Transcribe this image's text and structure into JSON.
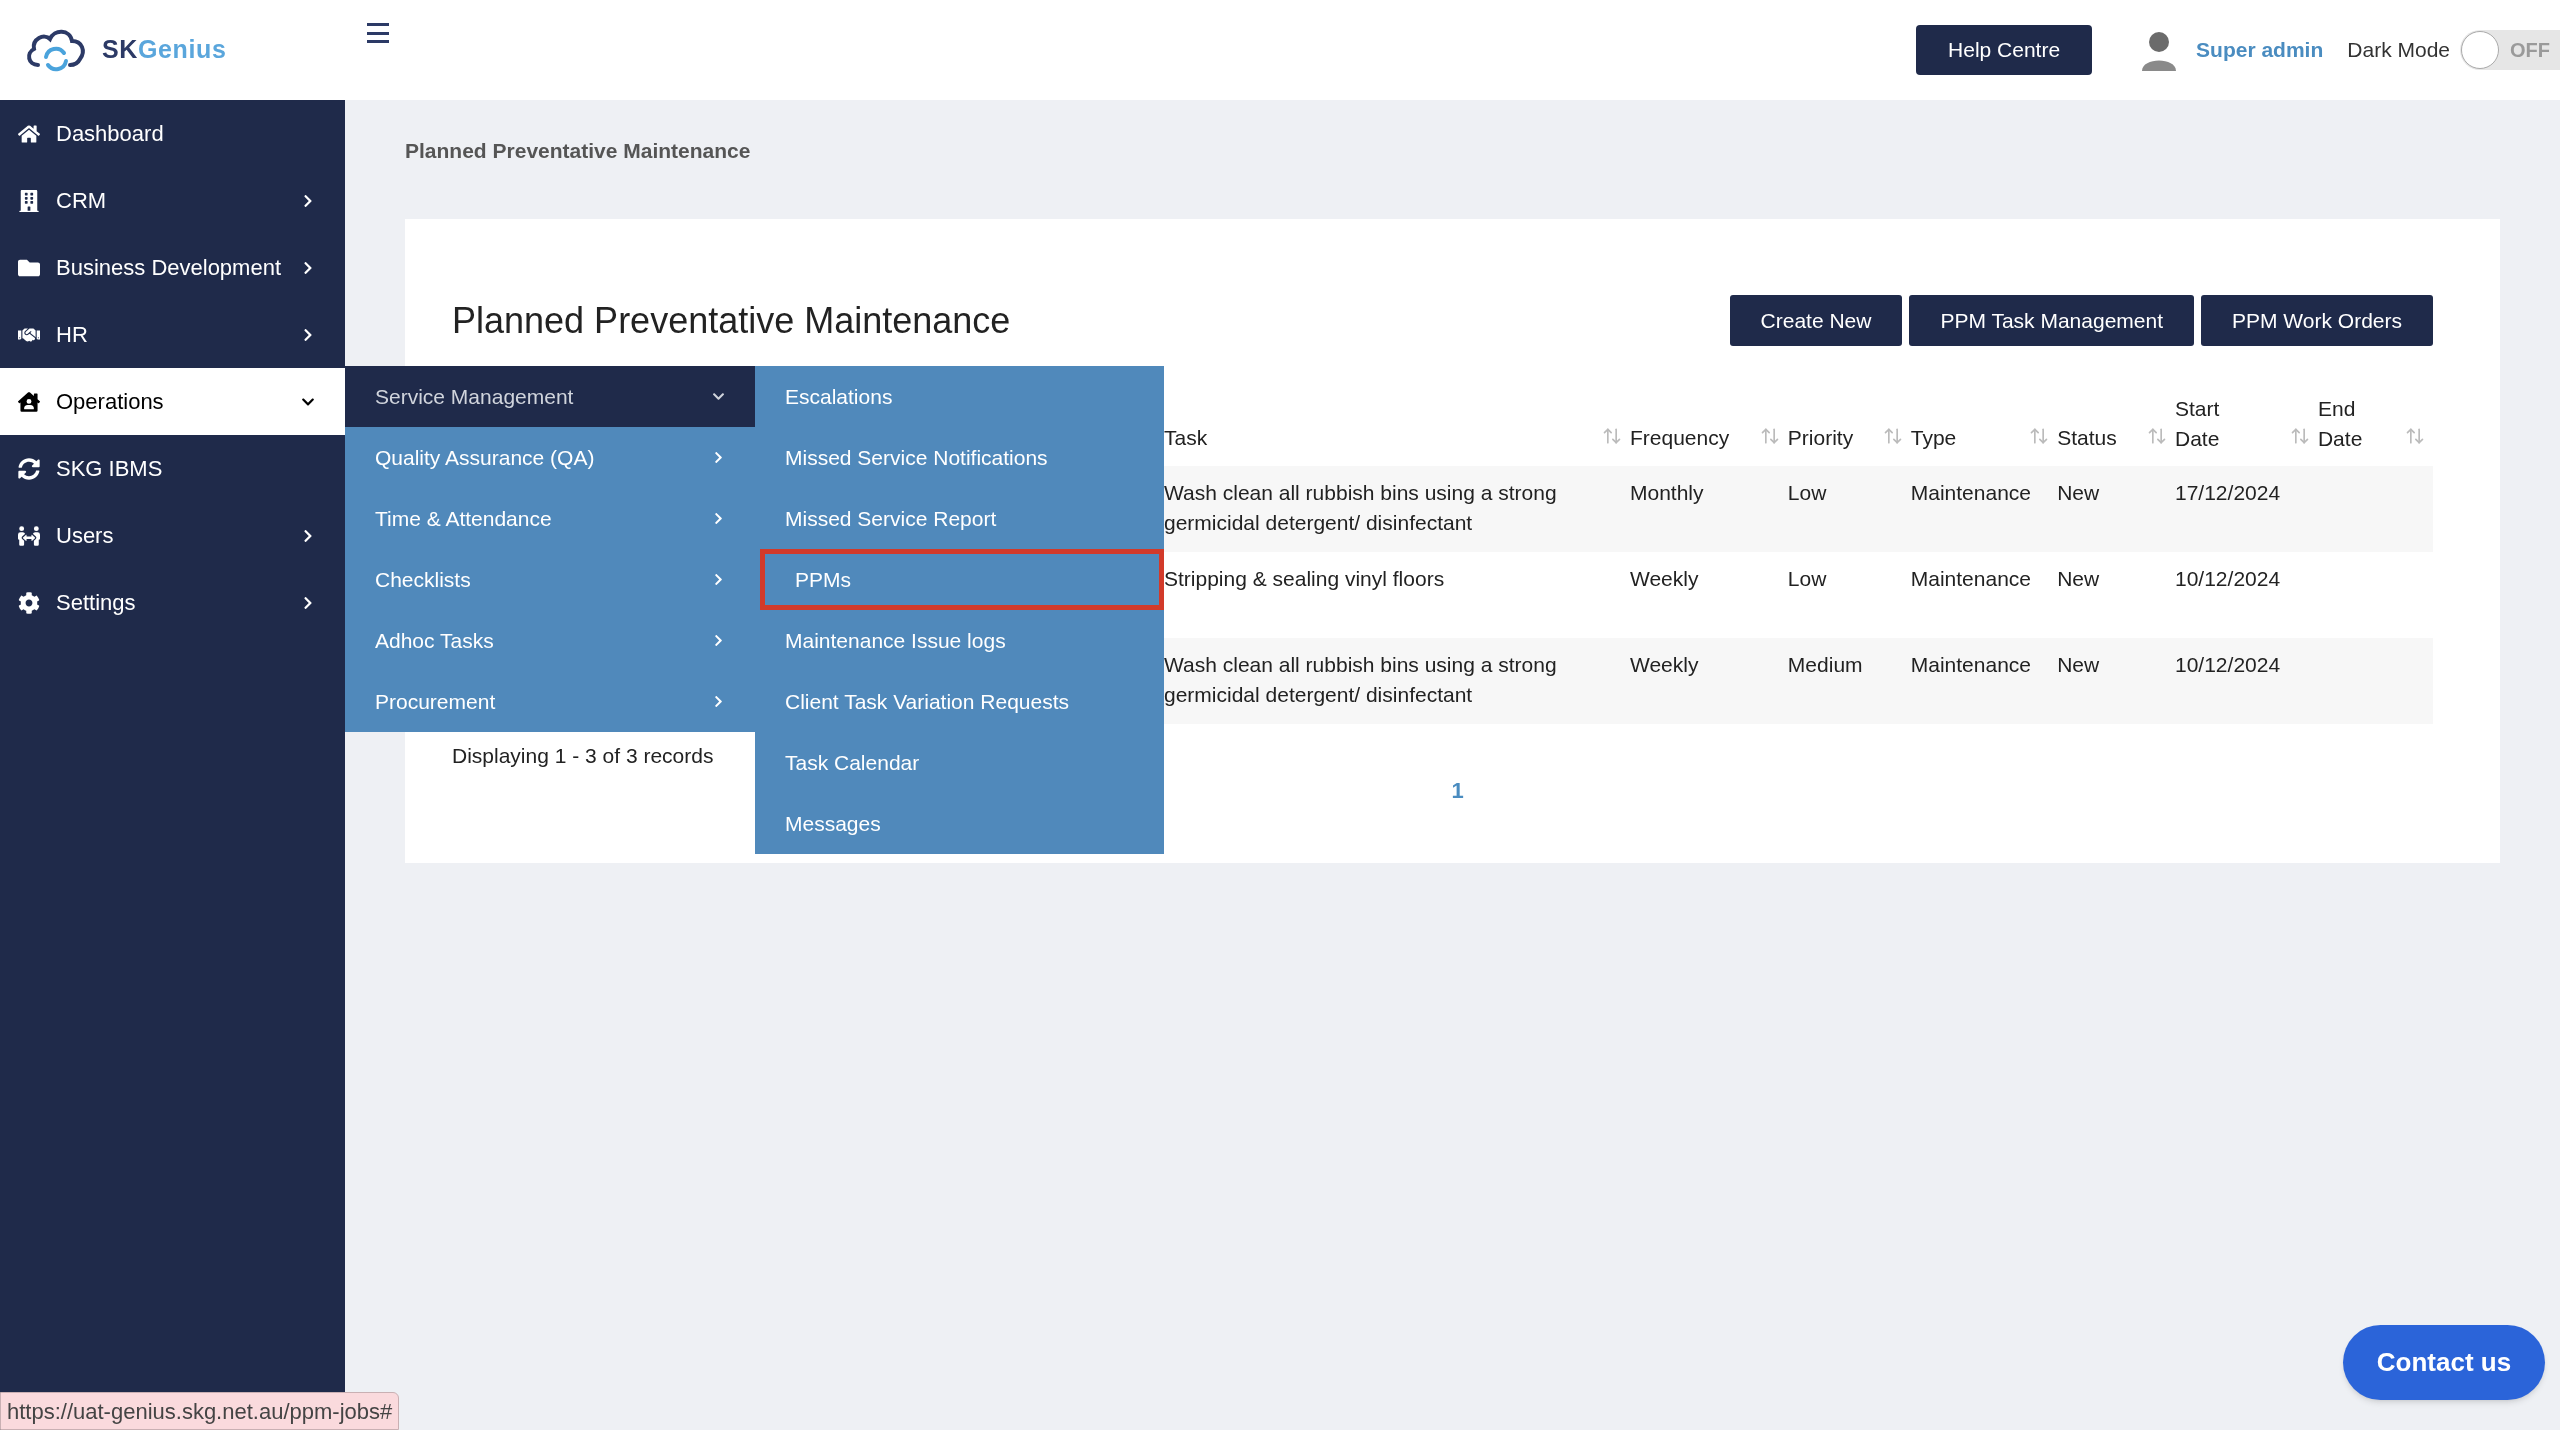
{
  "header": {
    "brand_parts": [
      "SK",
      "Genius"
    ],
    "help_button": "Help Centre",
    "user_name": "Super admin",
    "dark_mode": {
      "label": "Dark Mode",
      "on": false,
      "state_text": "OFF"
    }
  },
  "sidebar": {
    "items": [
      {
        "label": "Dashboard",
        "submenu": false,
        "selected": false
      },
      {
        "label": "CRM",
        "submenu": true,
        "selected": false,
        "expanded": false
      },
      {
        "label": "Business Development",
        "submenu": true,
        "selected": false,
        "expanded": false
      },
      {
        "label": "HR",
        "submenu": true,
        "selected": false,
        "expanded": false
      },
      {
        "label": "Operations",
        "submenu": true,
        "selected": true,
        "expanded": true
      },
      {
        "label": "SKG IBMS",
        "submenu": false,
        "selected": false
      },
      {
        "label": "Users",
        "submenu": true,
        "selected": false,
        "expanded": false
      },
      {
        "label": "Settings",
        "submenu": true,
        "selected": false,
        "expanded": false
      }
    ]
  },
  "operations_menu": [
    {
      "label": "Service Management",
      "expanded": true
    },
    {
      "label": "Quality Assurance (QA)",
      "expanded": false
    },
    {
      "label": "Time & Attendance",
      "expanded": false
    },
    {
      "label": "Checklists",
      "expanded": false
    },
    {
      "label": "Adhoc Tasks",
      "expanded": false
    },
    {
      "label": "Procurement",
      "expanded": false
    }
  ],
  "service_management_menu": [
    {
      "label": "Escalations",
      "highlighted": false
    },
    {
      "label": "Missed Service Notifications",
      "highlighted": false
    },
    {
      "label": "Missed Service Report",
      "highlighted": false
    },
    {
      "label": "PPMs",
      "highlighted": true
    },
    {
      "label": "Maintenance Issue logs",
      "highlighted": false
    },
    {
      "label": "Client Task Variation Requests",
      "highlighted": false
    },
    {
      "label": "Task Calendar",
      "highlighted": false
    },
    {
      "label": "Messages",
      "highlighted": false
    }
  ],
  "breadcrumb": "Planned Preventative Maintenance",
  "page": {
    "title": "Planned Preventative Maintenance",
    "actions": [
      "Create New",
      "PPM Task Management",
      "PPM Work Orders"
    ]
  },
  "table": {
    "columns": [
      "Task",
      "Frequency",
      "Priority",
      "Type",
      "Status",
      "Start Date",
      "End Date"
    ],
    "rows": [
      [
        "Wash clean all rubbish bins using a strong germicidal detergent/ disinfectant",
        "Monthly",
        "Low",
        "Maintenance",
        "New",
        "17/12/2024",
        ""
      ],
      [
        "Stripping & sealing vinyl floors",
        "Weekly",
        "Low",
        "Maintenance",
        "New",
        "10/12/2024",
        ""
      ],
      [
        "Wash clean all rubbish bins using a strong germicidal detergent/ disinfectant",
        "Weekly",
        "Medium",
        "Maintenance",
        "New",
        "10/12/2024",
        ""
      ]
    ]
  },
  "records_text": "Displaying 1 - 3 of 3 records",
  "pagination": [
    {
      "label": "1",
      "selected": true
    }
  ],
  "contact_button": "Contact us",
  "status_url": "https://uat-genius.skg.net.au/ppm-jobs#"
}
